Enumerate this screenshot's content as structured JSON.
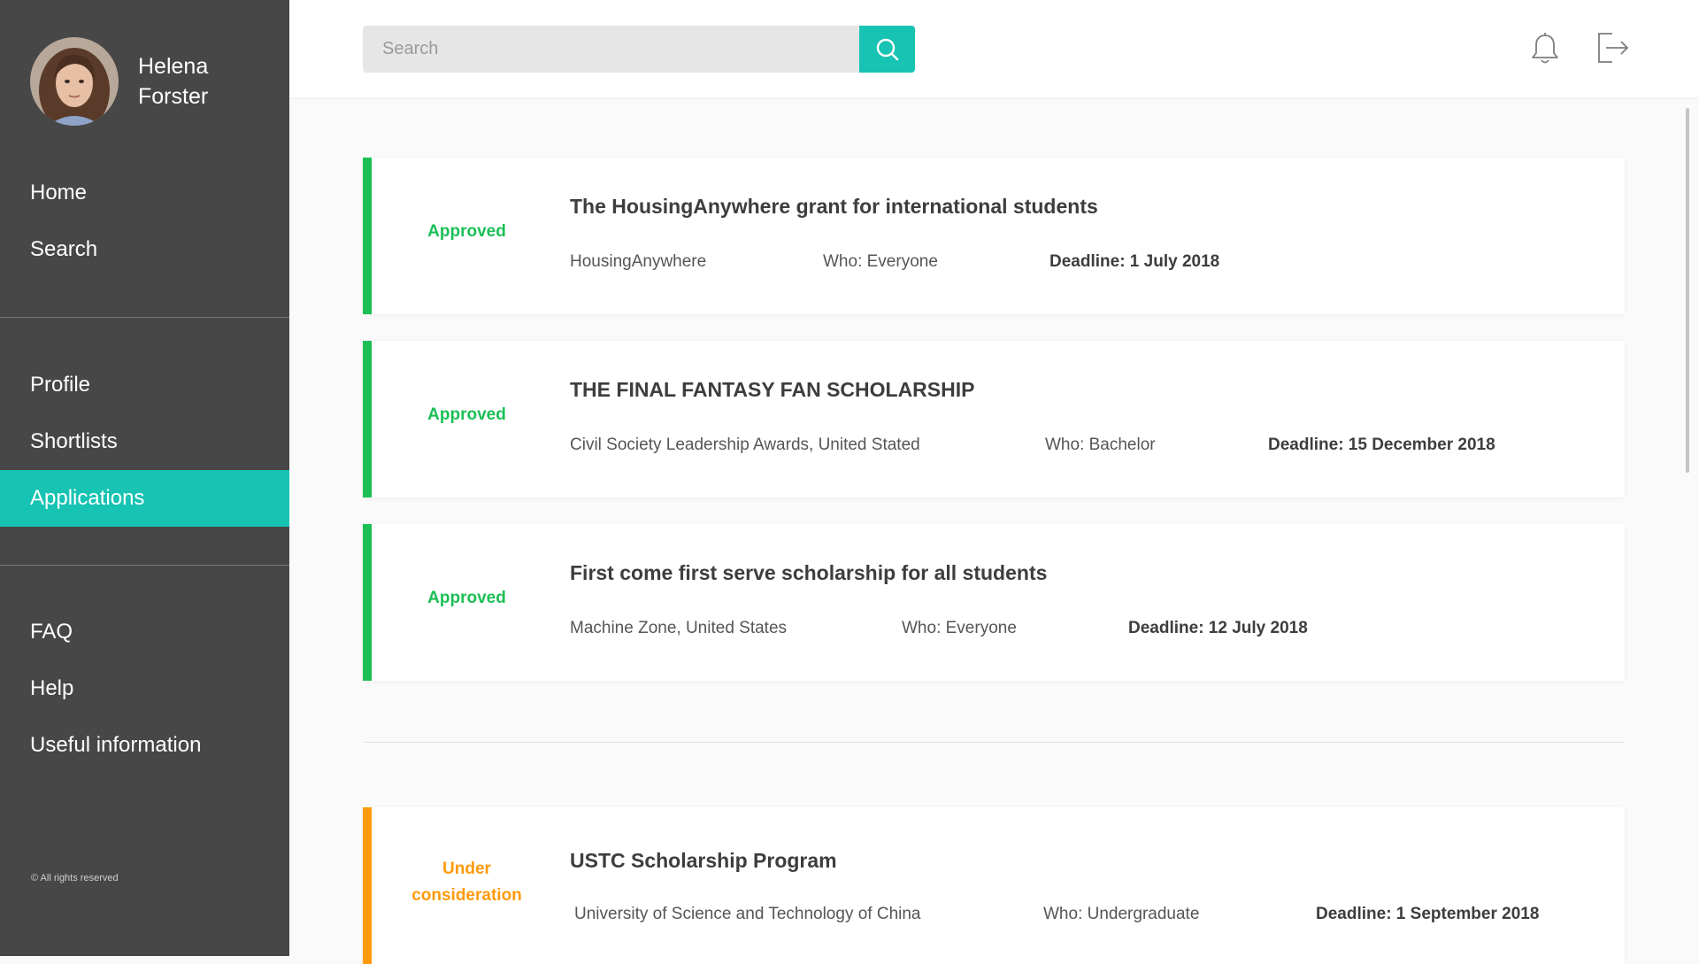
{
  "user": {
    "name": "Helena Forster"
  },
  "nav": {
    "primary": [
      {
        "label": "Home"
      },
      {
        "label": "Search"
      }
    ],
    "secondary": [
      {
        "label": "Profile"
      },
      {
        "label": "Shortlists"
      },
      {
        "label": "Applications",
        "active": true
      }
    ],
    "tertiary": [
      {
        "label": "FAQ"
      },
      {
        "label": "Help"
      },
      {
        "label": "Useful information"
      }
    ]
  },
  "footer": {
    "copyright": "© All rights reserved"
  },
  "search": {
    "placeholder": "Search",
    "value": ""
  },
  "icons": {
    "search": "search-icon",
    "notifications": "bell-icon",
    "logout": "logout-icon"
  },
  "colors": {
    "accent": "#17c3b2",
    "sidebar": "#474747",
    "approved": "#1bbf55",
    "under_consideration": "#ff9a0d"
  },
  "applications": [
    {
      "status": "Approved",
      "title": "The HousingAnywhere grant for international students",
      "provider": "HousingAnywhere",
      "who": "Who: Everyone",
      "deadline": "Deadline: 1 July 2018"
    },
    {
      "status": "Approved",
      "title": "THE FINAL FANTASY FAN SCHOLARSHIP",
      "provider": "Civil Society Leadership Awards, United Stated",
      "who": "Who: Bachelor",
      "deadline": "Deadline: 15 December 2018"
    },
    {
      "status": "Approved",
      "title": "First come first serve scholarship for all students",
      "provider": "Machine Zone, United States",
      "who": "Who: Everyone",
      "deadline": "Deadline: 12 July 2018"
    },
    {
      "status": "Under consideration",
      "title": "USTC Scholarship Program",
      "provider": "University of Science and Technology of China",
      "who": "Who: Undergraduate",
      "deadline": "Deadline: 1 September 2018"
    }
  ]
}
